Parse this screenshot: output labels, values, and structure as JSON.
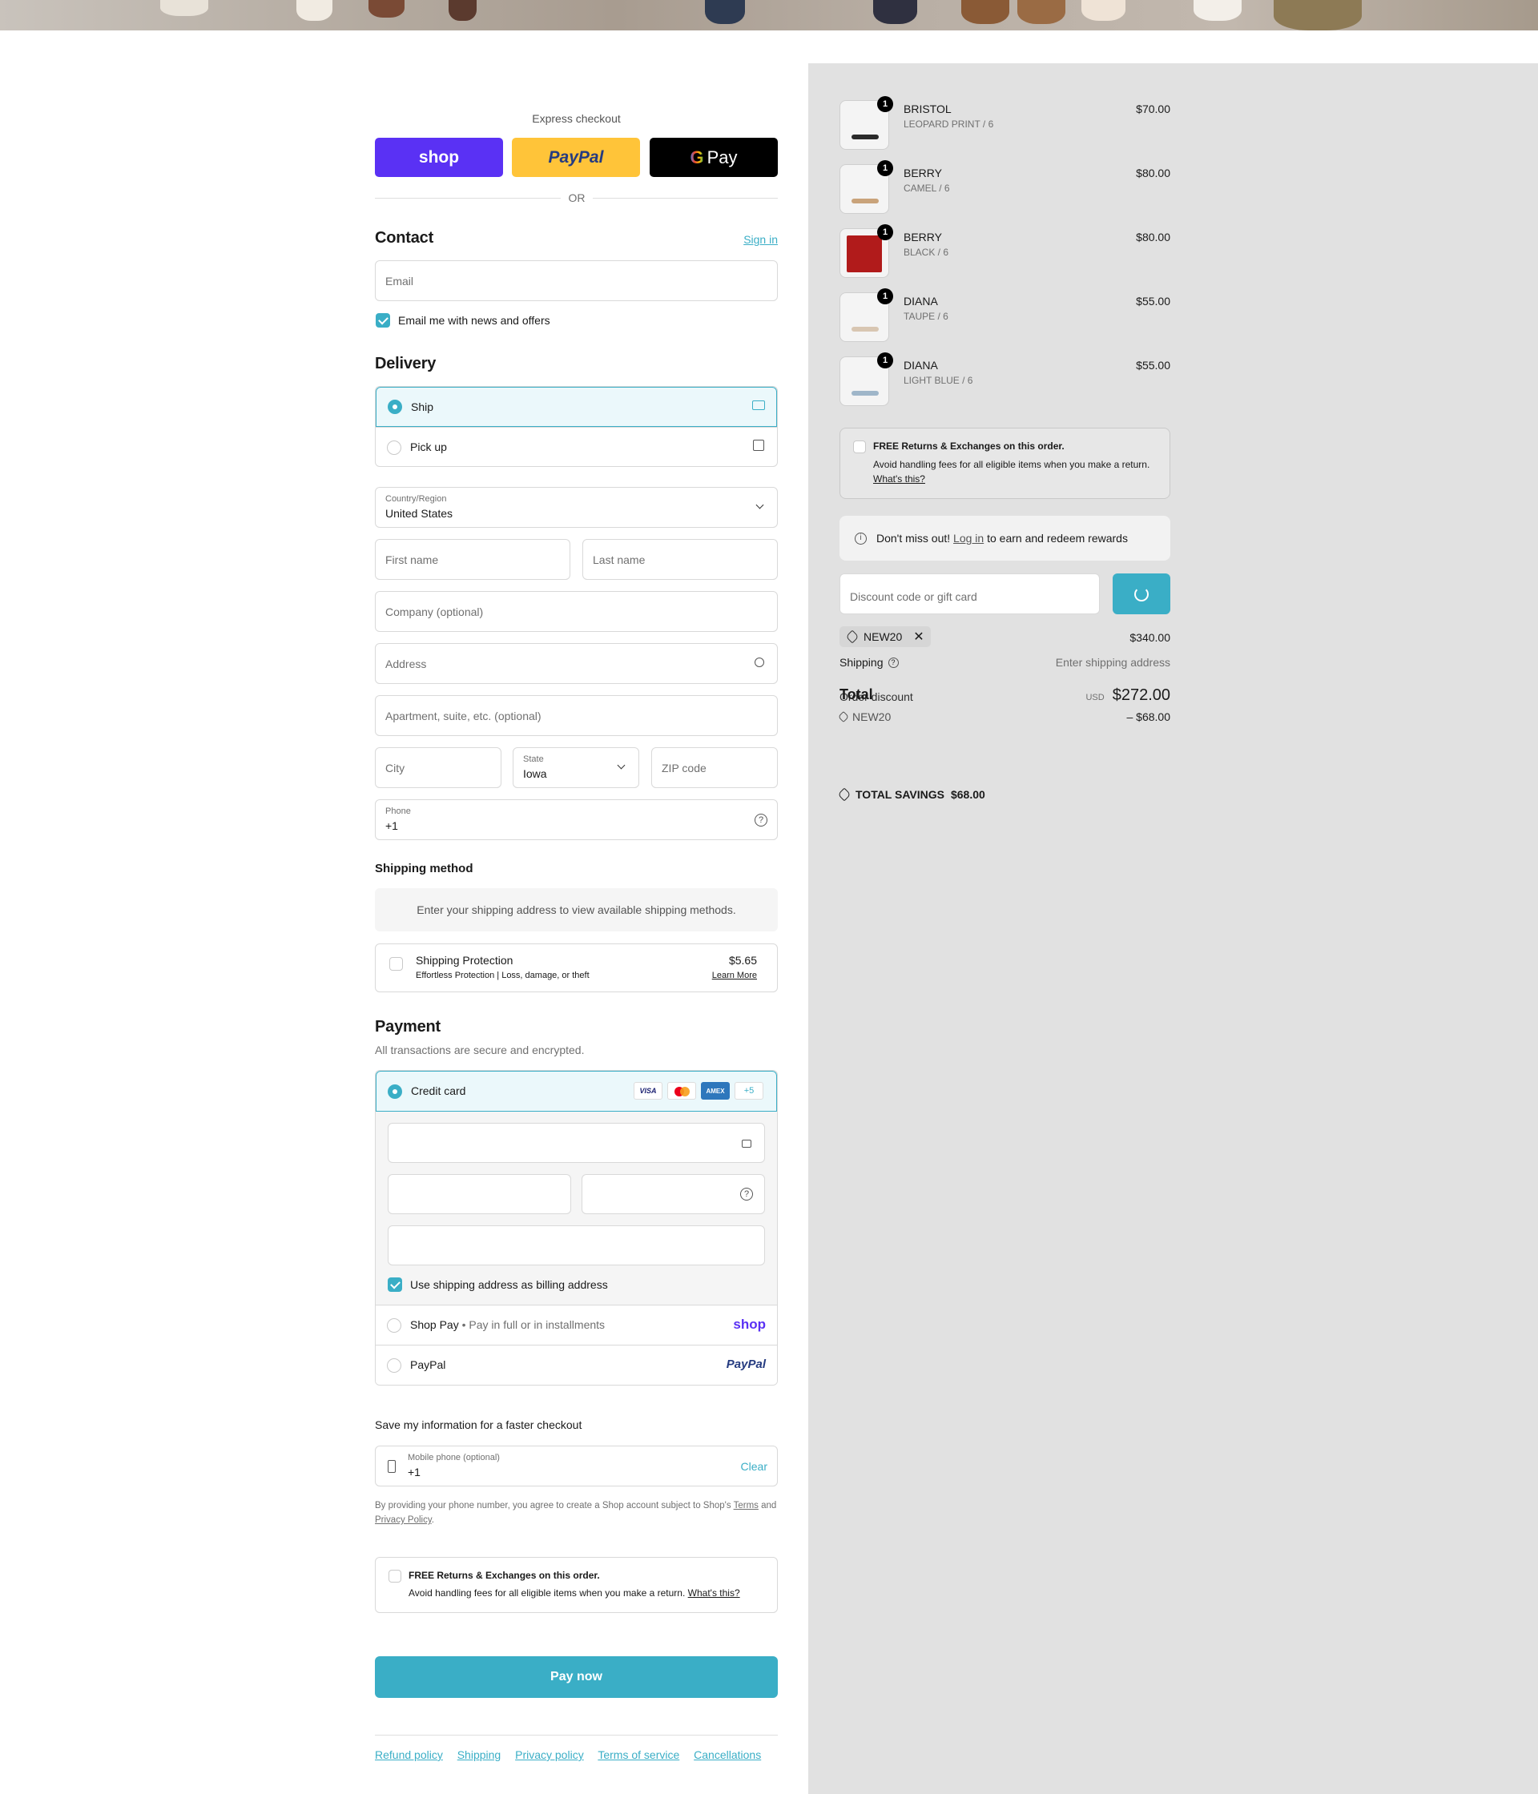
{
  "express": {
    "title": "Express checkout",
    "shop_label": "shop",
    "paypal_label": "PayPal",
    "gpay_label": "Pay",
    "or": "OR"
  },
  "contact": {
    "title": "Contact",
    "sign_in": "Sign in",
    "email_placeholder": "Email",
    "news_label": "Email me with news and offers",
    "news_checked": true
  },
  "delivery": {
    "title": "Delivery",
    "ship": "Ship",
    "pickup": "Pick up",
    "selected": "ship",
    "country_label": "Country/Region",
    "country_value": "United States",
    "first_name": "First name",
    "last_name": "Last name",
    "company": "Company (optional)",
    "address": "Address",
    "apartment": "Apartment, suite, etc. (optional)",
    "city": "City",
    "state_label": "State",
    "state_value": "Iowa",
    "zip": "ZIP code",
    "phone_label": "Phone",
    "phone_value": "+1"
  },
  "shipping_method": {
    "title": "Shipping method",
    "message": "Enter your shipping address to view available shipping methods."
  },
  "protection": {
    "title": "Shipping Protection",
    "desc": "Effortless Protection | Loss, damage, or theft",
    "price": "$5.65",
    "learn_more": "Learn More"
  },
  "payment": {
    "title": "Payment",
    "subtitle": "All transactions are secure and encrypted.",
    "credit_card": "Credit card",
    "card_brands": [
      "VISA",
      "MC",
      "AMEX"
    ],
    "more_brands": "+5",
    "billing_label": "Use shipping address as billing address",
    "shop_pay": "Shop Pay",
    "shop_pay_desc": "Pay in full or in installments",
    "shop_logo": "shop",
    "paypal": "PayPal",
    "paypal_logo": "PayPal"
  },
  "save_info": {
    "title": "Save my information for a faster checkout",
    "mobile_label": "Mobile phone (optional)",
    "mobile_value": "+1",
    "clear": "Clear",
    "legal_1": "By providing your phone number, you agree to create a Shop account subject to Shop's",
    "terms": "Terms",
    "and": "and",
    "privacy": "Privacy Policy",
    "period": "."
  },
  "returns": {
    "title": "FREE Returns & Exchanges on this order.",
    "desc": "Avoid handling fees for all eligible items when you make a return.",
    "whats_this": "What's this?"
  },
  "pay_now": "Pay now",
  "footer_links": [
    "Refund policy",
    "Shipping",
    "Privacy policy",
    "Terms of service",
    "Cancellations"
  ],
  "cart": {
    "items": [
      {
        "name": "BRISTOL",
        "variant": "LEOPARD PRINT / 6",
        "price": "$70.00",
        "qty": "1"
      },
      {
        "name": "BERRY",
        "variant": "CAMEL / 6",
        "price": "$80.00",
        "qty": "1"
      },
      {
        "name": "BERRY",
        "variant": "BLACK / 6",
        "price": "$80.00",
        "qty": "1"
      },
      {
        "name": "DIANA",
        "variant": "TAUPE / 6",
        "price": "$55.00",
        "qty": "1"
      },
      {
        "name": "DIANA",
        "variant": "LIGHT BLUE / 6",
        "price": "$55.00",
        "qty": "1"
      }
    ],
    "rewards_pre": "Don't miss out!",
    "rewards_link": "Log in",
    "rewards_post": "to earn and redeem rewards",
    "discount_placeholder": "Discount code or gift card",
    "discount_code": "NEW20",
    "subtotal": "$340.00",
    "shipping_label": "Shipping",
    "shipping_value": "Enter shipping address",
    "total_label": "Total",
    "order_discount": "Order discount",
    "currency": "USD",
    "total": "$272.00",
    "discount_line_code": "NEW20",
    "discount_amount": "– $68.00",
    "savings_label": "TOTAL SAVINGS",
    "savings_value": "$68.00"
  },
  "colors": {
    "accent": "#3aaec6",
    "shop_purple": "#5a31f4",
    "paypal_yellow": "#ffc439",
    "panel_gray": "#e1e1e1"
  }
}
